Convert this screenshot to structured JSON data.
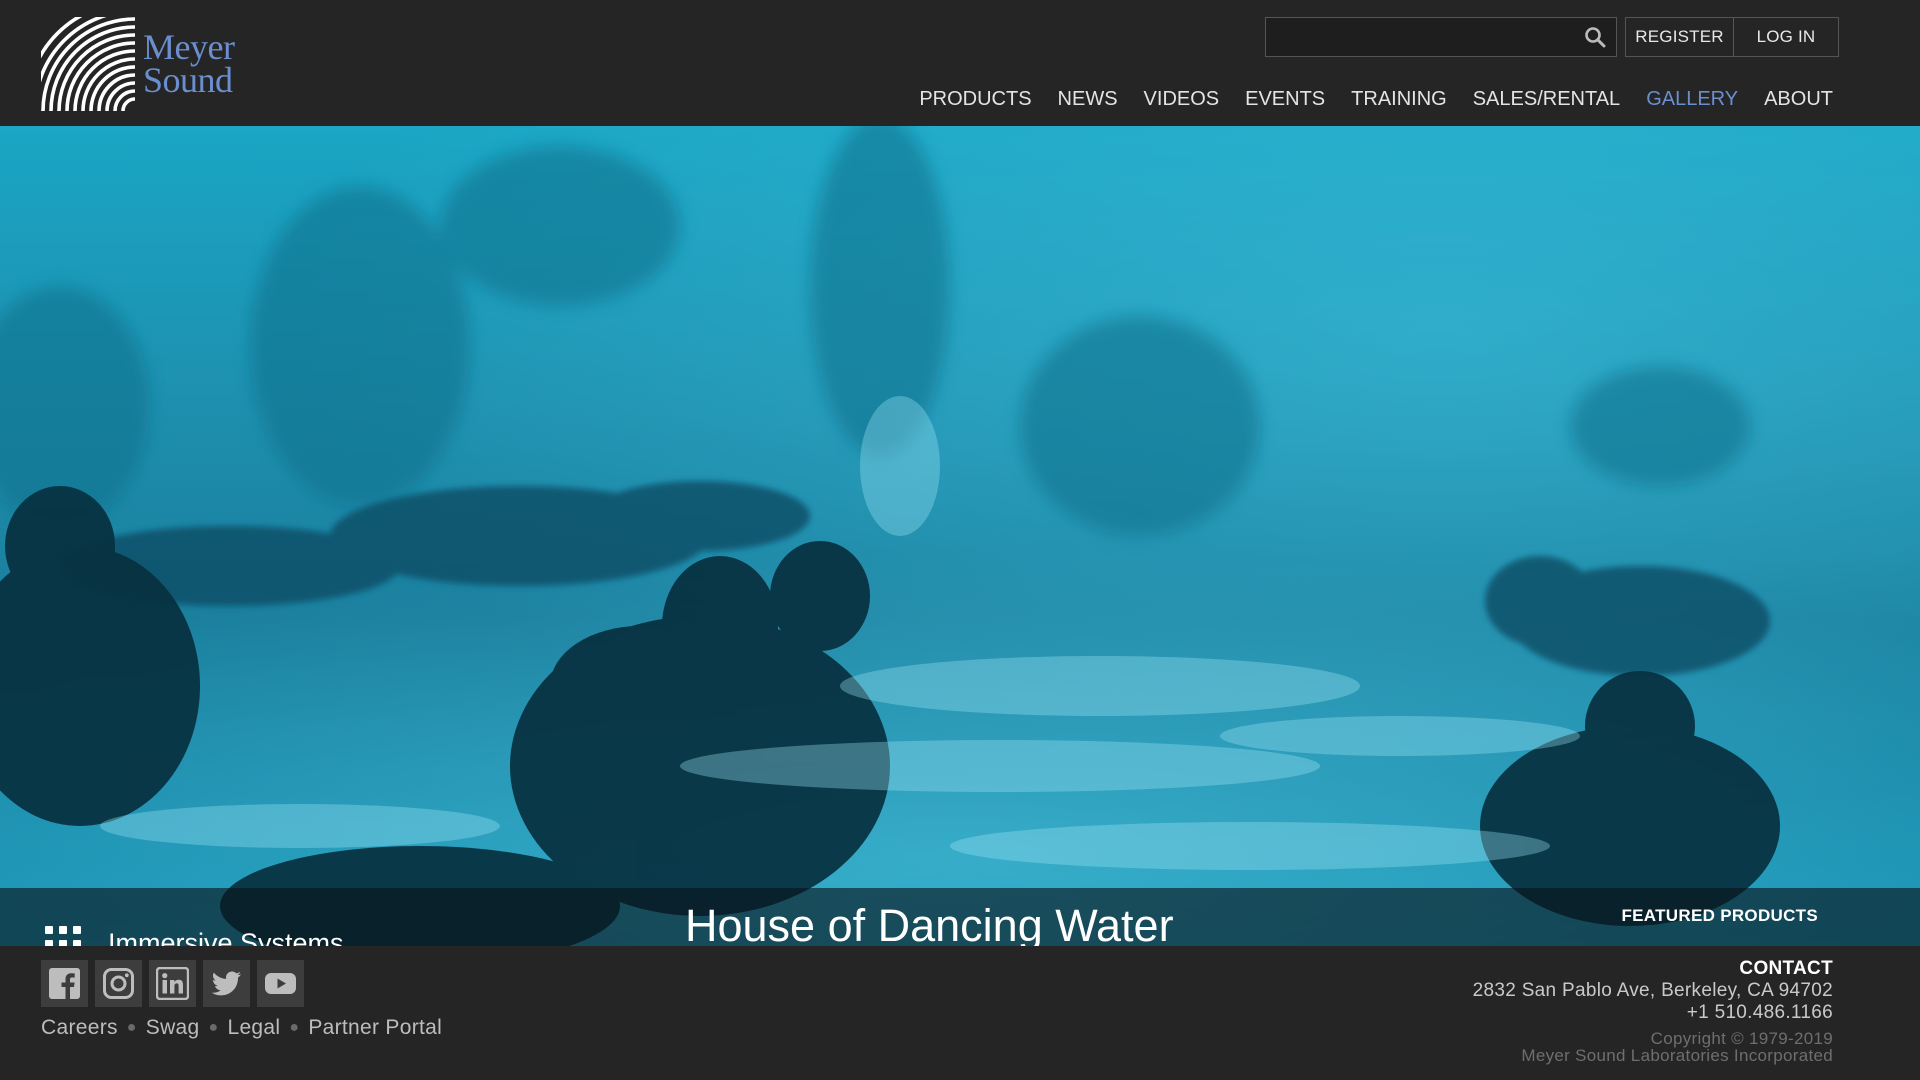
{
  "brand": {
    "logo_line1": "Meyer",
    "logo_line2": "Sound",
    "logo_color": "#6b8fce"
  },
  "header": {
    "search": {
      "value": "",
      "placeholder": "",
      "icon": "search-icon"
    },
    "register_label": "REGISTER",
    "login_label": "LOG IN",
    "nav": [
      {
        "label": "PRODUCTS",
        "active": false
      },
      {
        "label": "NEWS",
        "active": false
      },
      {
        "label": "VIDEOS",
        "active": false
      },
      {
        "label": "EVENTS",
        "active": false
      },
      {
        "label": "TRAINING",
        "active": false
      },
      {
        "label": "SALES/RENTAL",
        "active": false
      },
      {
        "label": "GALLERY",
        "active": true
      },
      {
        "label": "ABOUT",
        "active": false
      }
    ]
  },
  "hero": {
    "category_icon": "grid-icon",
    "category": "Immersive Systems",
    "title": "House of Dancing Water",
    "featured_label": "FEATURED PRODUCTS"
  },
  "footer": {
    "social": [
      {
        "name": "facebook-icon"
      },
      {
        "name": "instagram-icon"
      },
      {
        "name": "linkedin-icon"
      },
      {
        "name": "twitter-icon"
      },
      {
        "name": "youtube-icon"
      }
    ],
    "links": [
      "Careers",
      "Swag",
      "Legal",
      "Partner Portal"
    ],
    "contact": {
      "heading": "CONTACT",
      "address": "2832 San Pablo Ave, Berkeley, CA 94702",
      "phone": "+1 510.486.1166",
      "copyright": "Copyright © 1979-2019",
      "company": "Meyer Sound Laboratories Incorporated"
    }
  },
  "colors": {
    "background": "#252525",
    "accent": "#6b8fce",
    "hero_tint": "#1aa0c0"
  }
}
